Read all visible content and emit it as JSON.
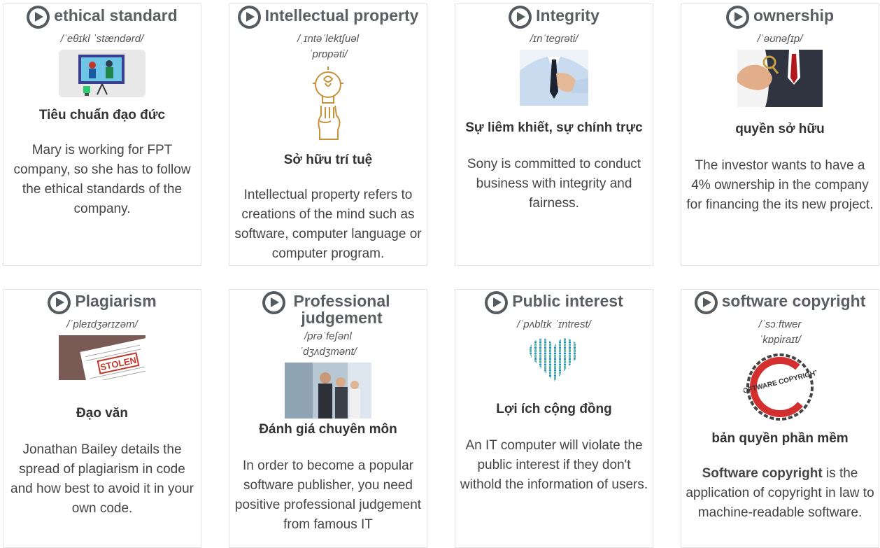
{
  "cards": [
    {
      "word": "ethical standard",
      "ipa": "/ˈeθɪkl ˈstændərd/",
      "meaning": "Tiêu chuẩn đạo đức",
      "example": "Mary is working for FPT company, so she has to follow the ethical standards of the company.",
      "image": "ethics-presentation-illustration"
    },
    {
      "word": "Intellectual property",
      "ipa": "/ˌɪntəˈlektʃuəl ˈprɒpəti/",
      "meaning": "Sở hữu trí tuệ",
      "example": "Intellectual property refers to creations of the mind such as software, computer language or computer program.",
      "image": "lightbulb-hand-icon"
    },
    {
      "word": "Integrity",
      "ipa": "/ɪnˈtegrəti/",
      "meaning": "Sự liêm khiết, sự chính trực",
      "example": "Sony is committed to conduct business with integrity and fairness.",
      "image": "hand-on-chest-photo"
    },
    {
      "word": "ownership",
      "ipa": "/ˈəʊnəʃɪp/",
      "meaning": "quyền sở hữu",
      "example": "The investor wants to have a 4% ownership in the company for financing the its new project.",
      "image": "key-in-hand-photo"
    },
    {
      "word": "Plagiarism",
      "ipa": "/ˈpleɪdʒərɪzəm/",
      "meaning": "Đạo văn",
      "example": "Jonathan Bailey details the spread of plagiarism in code and how best to avoid it in your own code.",
      "image": "stolen-stamp-photo",
      "stamp": "STOLEN"
    },
    {
      "word": "Professional judgement",
      "ipa": "/prəˈfeʃənl ˈdʒʌdʒmənt/",
      "meaning": "Đánh giá chuyên môn",
      "example": "In order to become a popular software publisher, you need positive professional judgement from famous IT",
      "image": "business-people-photo"
    },
    {
      "word": "Public interest",
      "ipa": "/ˈpʌblɪk ˈɪntrest/",
      "meaning": "Lợi ích cộng đồng",
      "example": "An IT computer will violate the public interest if they don't withold the information of users.",
      "image": "people-heart-icon"
    },
    {
      "word": "software copyright",
      "ipa": "/ˈsɔːftwer ˈkɒpiraɪt/",
      "meaning": "bản quyền phần mềm",
      "example_bold": "Software copyright",
      "example_rest": " is the application of copyright in law to machine-readable software.",
      "image": "copyright-seal-icon",
      "seal": "SOFTWARE COPYRIGHT"
    }
  ]
}
